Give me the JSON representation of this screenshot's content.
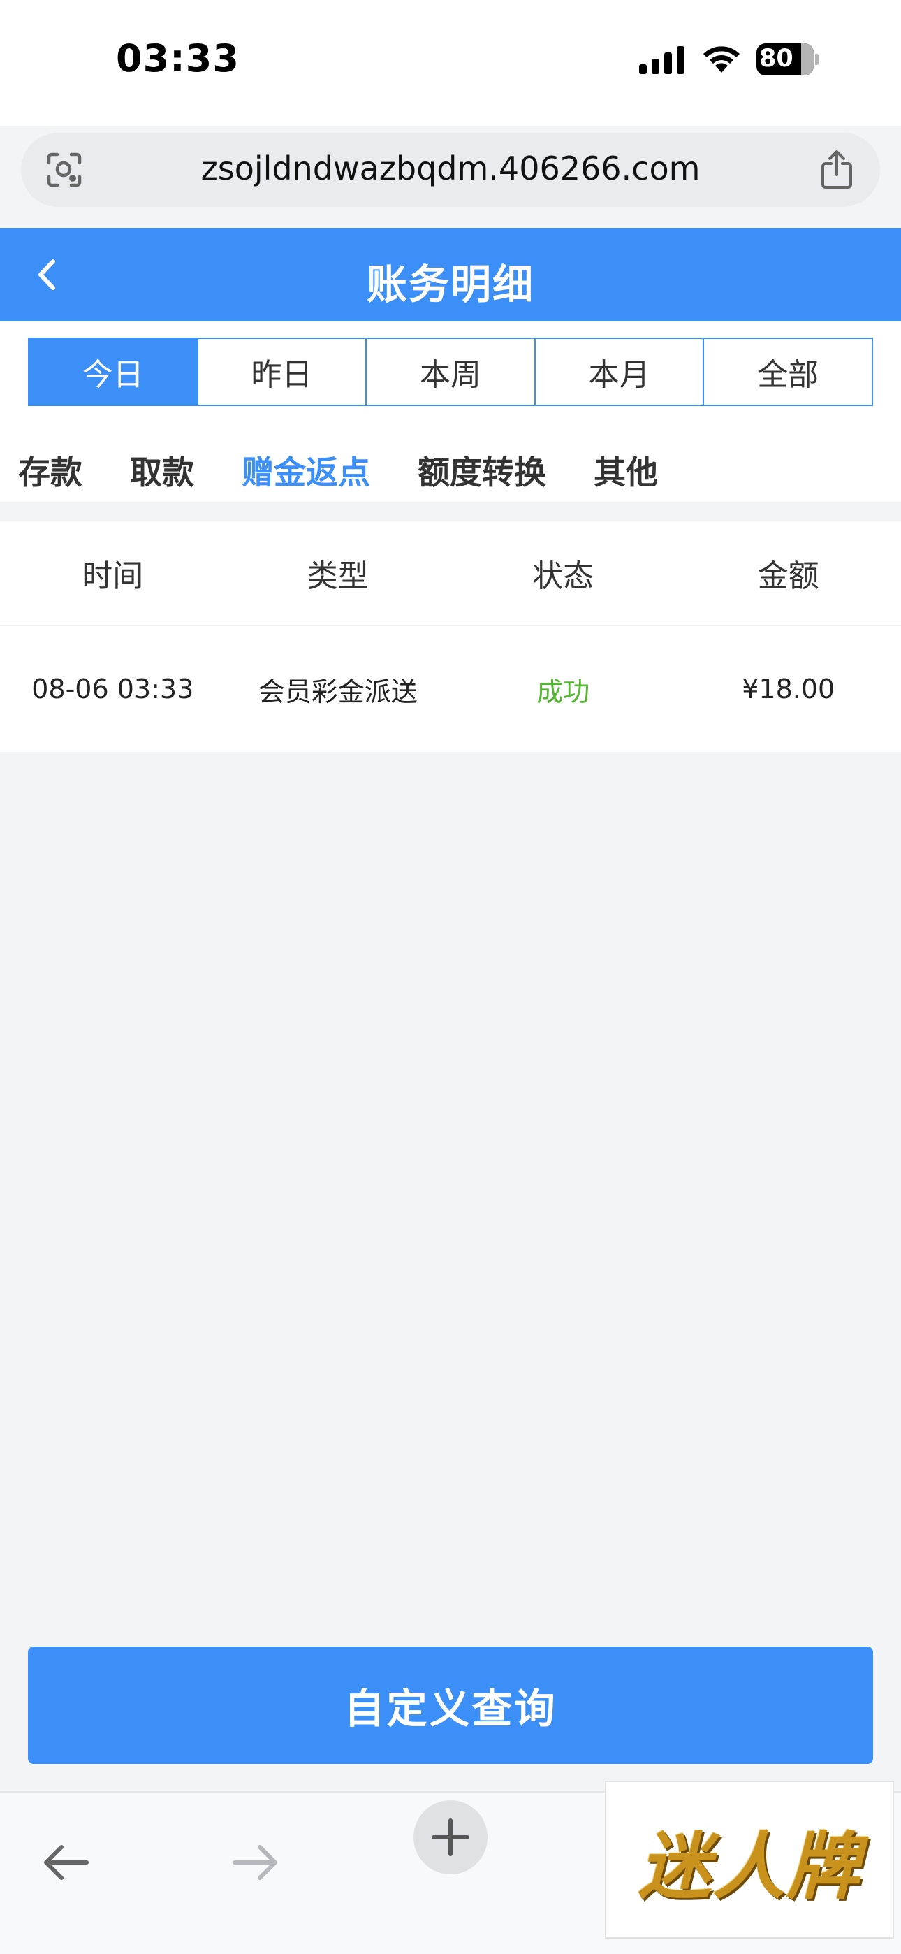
{
  "status_bar": {
    "time": "03:33",
    "battery": "80"
  },
  "browser": {
    "url": "zsojldndwazbqdm.406266.com"
  },
  "header": {
    "title": "账务明细"
  },
  "date_tabs": [
    {
      "label": "今日",
      "active": true
    },
    {
      "label": "昨日",
      "active": false
    },
    {
      "label": "本周",
      "active": false
    },
    {
      "label": "本月",
      "active": false
    },
    {
      "label": "全部",
      "active": false
    }
  ],
  "category_tabs": [
    {
      "label": "存款",
      "active": false
    },
    {
      "label": "取款",
      "active": false
    },
    {
      "label": "赠金返点",
      "active": true
    },
    {
      "label": "额度转换",
      "active": false
    },
    {
      "label": "其他",
      "active": false
    }
  ],
  "table": {
    "headers": [
      "时间",
      "类型",
      "状态",
      "金额"
    ],
    "rows": [
      {
        "time": "08-06 03:33",
        "type": "会员彩金派送",
        "status": "成功",
        "amount": "¥18.00"
      }
    ]
  },
  "query_button": "自定义查询",
  "watermark": "迷人牌",
  "colors": {
    "primary": "#3b8ff6",
    "success": "#52b62f",
    "background": "#f3f4f6"
  }
}
